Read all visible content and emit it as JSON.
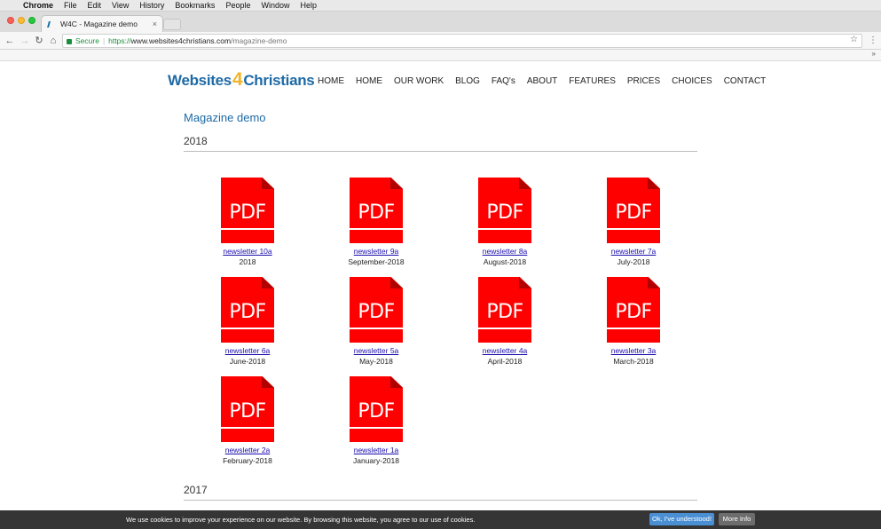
{
  "os_menu": {
    "app_name": "Chrome",
    "items": [
      "File",
      "Edit",
      "View",
      "History",
      "Bookmarks",
      "People",
      "Window",
      "Help"
    ]
  },
  "browser": {
    "tab_title": "W4C - Magazine demo",
    "tab_close": "×",
    "secure_label": "Secure",
    "url_protocol": "https://",
    "url_host": "www.websites4christians.com",
    "url_path": "/magazine-demo",
    "bookmarks_overflow": "»"
  },
  "site": {
    "logo_left": "Websites",
    "logo_four": "4",
    "logo_right": "Christians",
    "nav": [
      "HOME",
      "HOME",
      "OUR WORK",
      "BLOG",
      "FAQ's",
      "ABOUT",
      "FEATURES",
      "PRICES",
      "CHOICES",
      "CONTACT"
    ]
  },
  "main": {
    "page_title": "Magazine demo",
    "year_2018": "2018",
    "year_2017": "2017",
    "pdf_label": "PDF",
    "newsletters": [
      {
        "link": "newsletter 10a",
        "date": "2018"
      },
      {
        "link": "newsletter 9a",
        "date": "September-2018"
      },
      {
        "link": "newsletter 8a",
        "date": "August-2018"
      },
      {
        "link": "newsletter 7a",
        "date": "July-2018"
      },
      {
        "link": "newsletter 6a",
        "date": "June-2018"
      },
      {
        "link": "newsletter 5a",
        "date": "May-2018"
      },
      {
        "link": "newsletter 4a",
        "date": "April-2018"
      },
      {
        "link": "newsletter 3a",
        "date": "March-2018"
      },
      {
        "link": "newsletter 2a",
        "date": "February-2018"
      },
      {
        "link": "newsletter 1a",
        "date": "January-2018"
      }
    ]
  },
  "cookie": {
    "message": "We use cookies to improve your experience on our website. By browsing this website, you agree to our use of cookies.",
    "ok_label": "Ok, I've understood!",
    "more_label": "More Info"
  },
  "colors": {
    "brand_blue": "#1e6aa6",
    "pdf_red": "#ff0000",
    "link_blue": "#1a0dab"
  }
}
